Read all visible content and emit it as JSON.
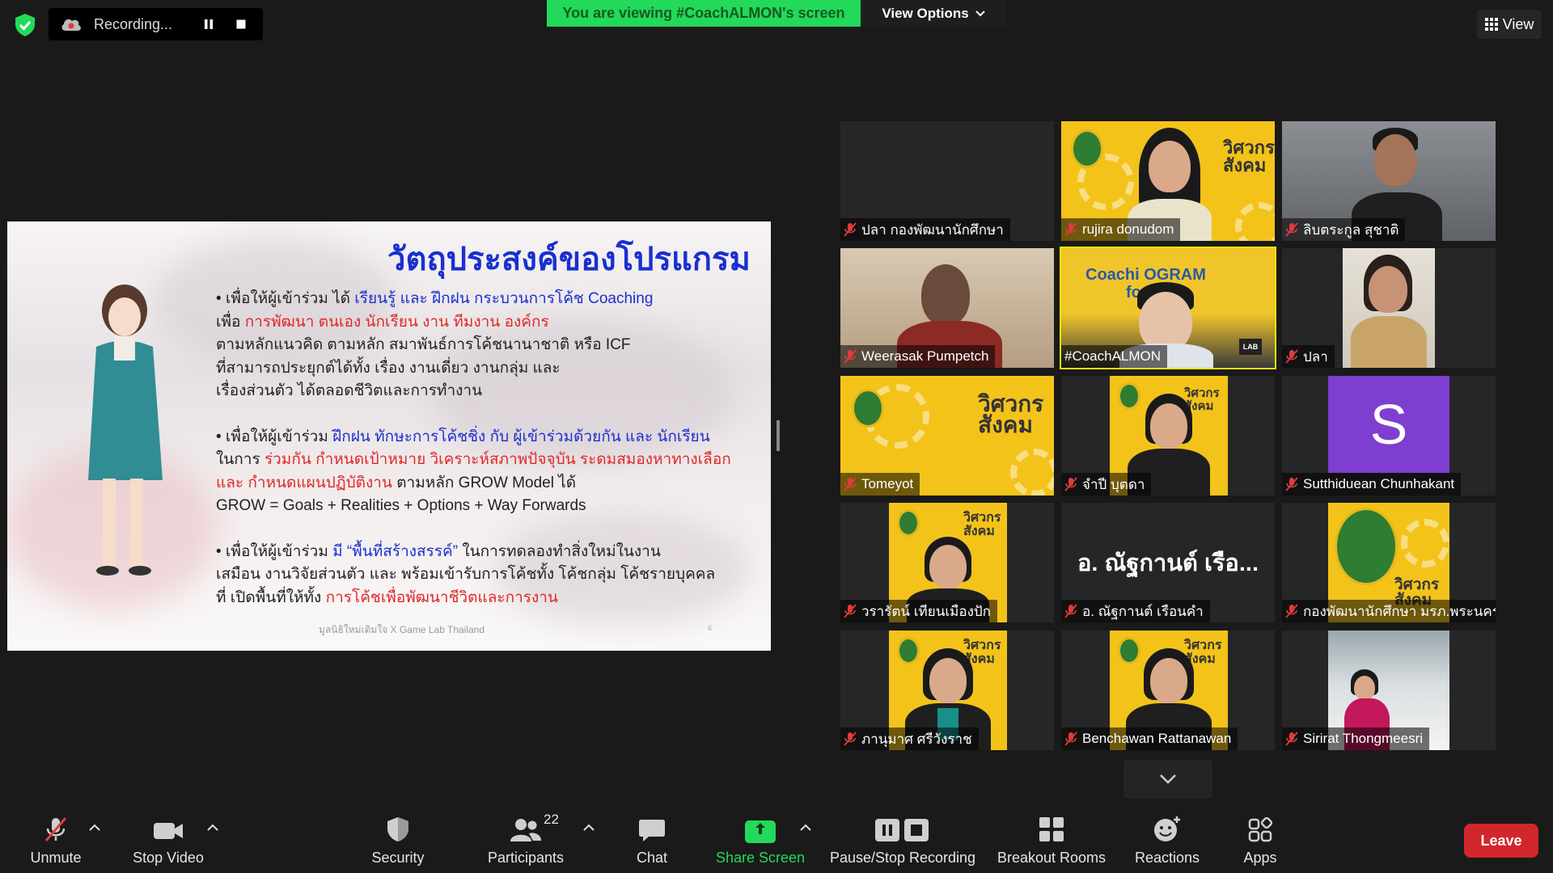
{
  "top": {
    "recording_label": "Recording...",
    "viewing_banner": "You are viewing #CoachALMON's screen",
    "view_options": "View Options",
    "view_button": "View"
  },
  "slide": {
    "title": "วัตถุประสงค์ของโปรแกรม",
    "b1_a": "• เพื่อให้ผู้เข้าร่วม ได้ ",
    "b1_b": "เรียนรู้ และ ฝึกฝน กระบวนการโค้ช Coaching",
    "b1_c": "เพื่อ ",
    "b1_d": "การพัฒนา ตนเอง นักเรียน งาน ทีมงาน องค์กร",
    "b1_e": "ตามหลักแนวคิด ตามหลัก สมาพันธ์การโค้ชนานาชาติ หรือ ICF",
    "b1_f": "ที่สามารถประยุกต์ได้ทั้ง เรื่อง งานเดี่ยว งานกลุ่ม และ",
    "b1_g": "เรื่องส่วนตัว ได้ตลอดชีวิตและการทำงาน",
    "b2_a": "• เพื่อให้ผู้เข้าร่วม ",
    "b2_b": "ฝึกฝน ทักษะการโค้ชชิ่ง กับ ผู้เข้าร่วมด้วยกัน และ นักเรียน",
    "b2_c": "ในการ ",
    "b2_d": "ร่วมกัน กำหนดเป้าหมาย วิเคราะห์สภาพปัจจุบัน ระดมสมองหาทางเลือก",
    "b2_e": "และ กำหนดแผนปฏิบัติงาน",
    "b2_f": " ตามหลัก GROW Model ได้",
    "b2_g": "GROW = Goals + Realities + Options + Way Forwards",
    "b3_a": "• เพื่อให้ผู้เข้าร่วม ",
    "b3_b": "มี “พื้นที่สร้างสรรค์”",
    "b3_c": " ในการทดลองทำสิ่งใหม่ในงาน",
    "b3_d": "เสมือน งานวิจัยส่วนตัว และ พร้อมเข้ารับการโค้ชทั้ง โค้ชกลุ่ม โค้ชรายบุคคล",
    "b3_e": "ที่ เปิดพื้นที่ให้ทั้ง ",
    "b3_f": "การโค้ชเพื่อพัฒนาชีวิตและการงาน",
    "footer": "มูลนิธิใหม่เติมใจ X Game Lab Thailand",
    "page": "6"
  },
  "tiles": [
    {
      "name": "ปลา กองพัฒนานักศึกษา"
    },
    {
      "name": "rujira donudom",
      "logo": "วิศวกรสังคม"
    },
    {
      "name": "ลิบตระกูล สุชาติ"
    },
    {
      "name": "Weerasak Pumpetch"
    },
    {
      "name": "#CoachALMON",
      "screen_text": "Coachi   OGRAM",
      "screen_text2": "fo     er",
      "lab": "LAB"
    },
    {
      "name": "ปลา"
    },
    {
      "name": "Tomeyot",
      "logo": "วิศวกรสังคม"
    },
    {
      "name": "จำปี บุตดา",
      "logo": "วิศวกรสังคม"
    },
    {
      "name": "Sutthiduean Chunhakant",
      "avatar": "S"
    },
    {
      "name": "วรารัตน์ เทียนเมืองปัก",
      "logo": "วิศวกรสังคม"
    },
    {
      "name": "อ. ณัฐกานต์ เรือนคำ",
      "card": "อ. ณัฐกานต์  เรือ..."
    },
    {
      "name": "กองพัฒนานักศึกษา มรภ.พระนคร",
      "logo": "วิศวกรสังคม"
    },
    {
      "name": "ภานุมาศ ศรีวังราช",
      "logo": "วิศวกรสังคม"
    },
    {
      "name": "Benchawan Rattanawan",
      "logo": "วิศวกรสังคม"
    },
    {
      "name": "Sirirat Thongmeesri"
    }
  ],
  "toolbar": {
    "unmute": "Unmute",
    "stop_video": "Stop Video",
    "security": "Security",
    "participants": "Participants",
    "participant_count": "22",
    "chat": "Chat",
    "share_screen": "Share Screen",
    "pause_stop": "Pause/Stop Recording",
    "breakout": "Breakout Rooms",
    "reactions": "Reactions",
    "apps": "Apps",
    "leave": "Leave"
  },
  "colors": {
    "viewing_banner": "#23d959",
    "leave": "#d1262c",
    "active_speaker": "#f1e200",
    "slide_blue": "#1a2fd1",
    "slide_red": "#e02828",
    "avatar_purple": "#7e3ed0",
    "logo_yellow": "#f3c31a"
  }
}
